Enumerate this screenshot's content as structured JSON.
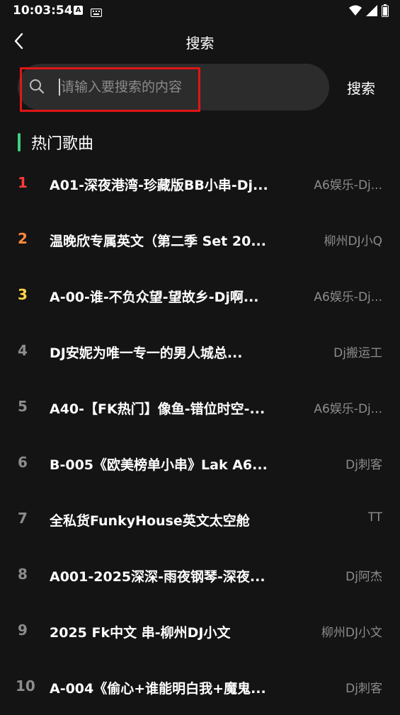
{
  "status_bar": {
    "time": "10:03:54",
    "notification_icon_letter": "A"
  },
  "header": {
    "title": "搜索"
  },
  "search": {
    "placeholder": "请输入要搜索的内容",
    "button_label": "搜索"
  },
  "section": {
    "title": "热门歌曲",
    "accent_color": "#3fd07a"
  },
  "colors": {
    "rank_1": "#ff3b3b",
    "rank_2": "#ff8a3d",
    "rank_3": "#ffd54a",
    "rank_default": "#8c8c8c",
    "highlight_box": "#e01616"
  },
  "songs": [
    {
      "rank": "1",
      "title": "A01-深夜港湾-珍藏版BB小串-Dj...",
      "artist": "A6娱乐-Dj..."
    },
    {
      "rank": "2",
      "title": "温晚欣专属英文（第二季 Set 20...",
      "artist": "柳州DJ小Q"
    },
    {
      "rank": "3",
      "title": "A-00-谁-不负众望-望故乡-Dj啊...",
      "artist": "A6娱乐-Dj..."
    },
    {
      "rank": "4",
      "title": "DJ安妮为唯一专一的男人城总...",
      "artist": "Dj搬运工"
    },
    {
      "rank": "5",
      "title": "A40-【FK热门】像鱼-错位时空-...",
      "artist": "A6娱乐-Dj..."
    },
    {
      "rank": "6",
      "title": "B-005《欧美榜单小串》Lak A6...",
      "artist": "Dj刺客"
    },
    {
      "rank": "7",
      "title": "全私货FunkyHouse英文太空舱",
      "artist": "TT"
    },
    {
      "rank": "8",
      "title": "A001-2025深深-雨夜钢琴-深夜...",
      "artist": "Dj阿杰"
    },
    {
      "rank": "9",
      "title": "2025 Fk中文 串-柳州DJ小文",
      "artist": "柳州DJ小文"
    },
    {
      "rank": "10",
      "title": "A-004《偷心+谁能明白我+魔鬼...",
      "artist": "Dj刺客"
    }
  ]
}
